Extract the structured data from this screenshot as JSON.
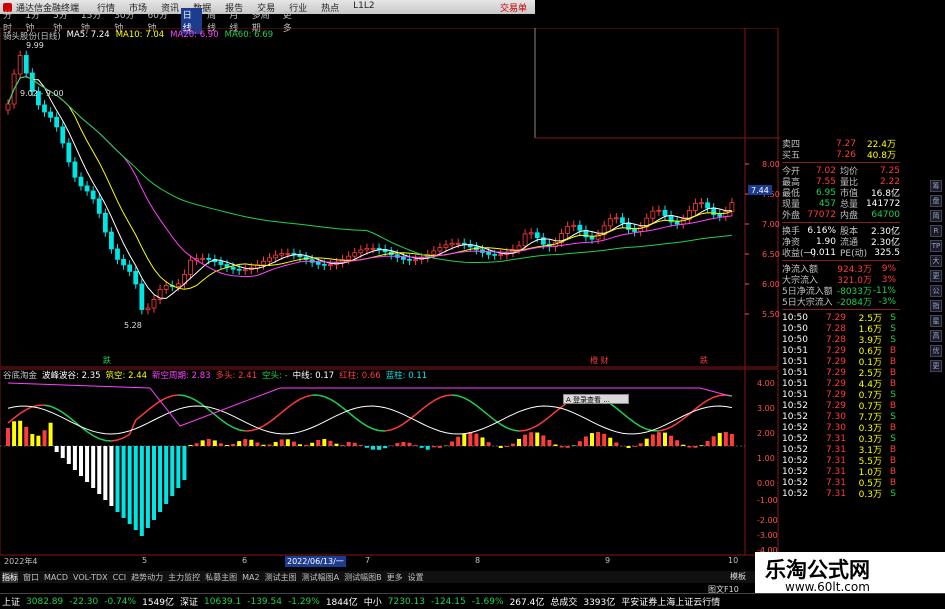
{
  "titlebar": {
    "app": "通达信金融终端",
    "menu": [
      "行情",
      "市场",
      "资讯",
      "数据",
      "报告",
      "交易",
      "行业",
      "热点",
      "L1L2"
    ],
    "badge": "交易单"
  },
  "periods": [
    "分时",
    "1分钟",
    "5分钟",
    "15分钟",
    "30分钟",
    "60分钟",
    "日线",
    "周线",
    "月线",
    "多周期",
    "更多"
  ],
  "selected_period": "日线",
  "ma_legend": {
    "name": "骑头股份(日线)",
    "items": [
      {
        "label": "MA5: 7.24",
        "color": "#ffffff"
      },
      {
        "label": "MA10: 7.04",
        "color": "#ffff00"
      },
      {
        "label": "MA20: 6.90",
        "color": "#ff40ff"
      },
      {
        "label": "MA60: 6.69",
        "color": "#20d050"
      }
    ]
  },
  "annotations": {
    "high": "9.99",
    "mid": "9.02 - 9.00",
    "low": "5.28",
    "tag_left": "跌",
    "tag_mid": "橙 财",
    "tag_right": "跌",
    "tooltip": "A 登录查看 ..."
  },
  "indicator_legend": [
    {
      "label": "谷底淘金",
      "color": "#c0c0c0"
    },
    {
      "label": "波峰波谷: 2.35",
      "color": "#ffffff"
    },
    {
      "label": "筑空: 2.44",
      "color": "#ffff00"
    },
    {
      "label": "新空周期: 2.83",
      "color": "#ff40ff"
    },
    {
      "label": "多头: 2.41",
      "color": "#ff3b3b"
    },
    {
      "label": "空头: -",
      "color": "#20d050"
    },
    {
      "label": "中线: 0.17",
      "color": "#ffffff"
    },
    {
      "label": "红柱: 0.66",
      "color": "#ff3b3b"
    },
    {
      "label": "蓝柱: 0.11",
      "color": "#00e5e5"
    }
  ],
  "price_axis": [
    "8.00",
    "7.50",
    "7.00",
    "6.50",
    "6.00",
    "5.50"
  ],
  "price_tag": "7.44",
  "ind_axis": [
    "4.00",
    "3.00",
    "2.00",
    "1.00",
    "0.00",
    "-1.00",
    "-2.00",
    "-3.00",
    "-4.00"
  ],
  "date_axis": [
    {
      "label": "2022年4",
      "color": "#c0c0c0"
    },
    {
      "label": "5",
      "color": "#c0c0c0"
    },
    {
      "label": "6",
      "color": "#c0c0c0"
    },
    {
      "label": "2022/06/13/一",
      "color": "#ffffff"
    },
    {
      "label": "7",
      "color": "#c0c0c0"
    },
    {
      "label": "8",
      "color": "#c0c0c0"
    },
    {
      "label": "9",
      "color": "#c0c0c0"
    },
    {
      "label": "10",
      "color": "#c0c0c0"
    }
  ],
  "bottom_tabs": [
    "指标",
    "窗口",
    "MACD",
    "VOL-TDX",
    "CCI",
    "趋势动力",
    "主力监控",
    "私募主图",
    "MA2",
    "测试主图",
    "测试幅图A",
    "测试幅图B",
    "更多",
    "设置"
  ],
  "bottom_right": "图文F10",
  "bottom_right2": "模板",
  "quote": {
    "asks_top": [
      {
        "k": "卖四",
        "p": "7.27",
        "v": "22.4万"
      },
      {
        "k": "买五",
        "p": "7.26",
        "v": "40.8万"
      }
    ],
    "stats": [
      {
        "k1": "今开",
        "v1": "7.02",
        "c1": "up",
        "k2": "均价",
        "v2": "7.25",
        "c2": "up"
      },
      {
        "k1": "最高",
        "v1": "7.55",
        "c1": "up",
        "k2": "量比",
        "v2": "2.22",
        "c2": "up"
      },
      {
        "k1": "最低",
        "v1": "6.95",
        "c1": "dn",
        "k2": "市值",
        "v2": "16.8亿",
        "c2": "wh"
      },
      {
        "k1": "现量",
        "v1": "457",
        "c1": "dn",
        "k2": "总量",
        "v2": "141772",
        "c2": "wh"
      },
      {
        "k1": "外盘",
        "v1": "77072",
        "c1": "up",
        "k2": "内盘",
        "v2": "64700",
        "c2": "dn"
      }
    ],
    "stats2": [
      {
        "k1": "换手",
        "v1": "6.16%",
        "k2": "股本",
        "v2": "2.30亿"
      },
      {
        "k1": "净资",
        "v1": "1.90",
        "k2": "流通",
        "v2": "2.30亿"
      },
      {
        "k1": "收益(一)",
        "v1": "0.011",
        "k2": "PE(动)",
        "v2": "325.5"
      }
    ],
    "flows": [
      {
        "k": "净流入额",
        "v": "924.3万",
        "p": "9%",
        "c": "up"
      },
      {
        "k": "大宗流入",
        "v": "321.0万",
        "p": "3%",
        "c": "up"
      },
      {
        "k": "5日净流入额",
        "v": "-8033万",
        "p": "-11%",
        "c": "dn"
      },
      {
        "k": "5日大宗流入",
        "v": "-2084万",
        "p": "-3%",
        "c": "dn"
      }
    ],
    "ticks": [
      {
        "t": "10:50",
        "p": "7.29",
        "v": "2.5万",
        "s": "S"
      },
      {
        "t": "10:50",
        "p": "7.28",
        "v": "1.6万",
        "s": "S"
      },
      {
        "t": "10:50",
        "p": "7.28",
        "v": "3.9万",
        "s": "S"
      },
      {
        "t": "10:51",
        "p": "7.29",
        "v": "0.6万",
        "s": "B"
      },
      {
        "t": "10:51",
        "p": "7.29",
        "v": "0.1万",
        "s": "B"
      },
      {
        "t": "10:51",
        "p": "7.29",
        "v": "2.5万",
        "s": "B"
      },
      {
        "t": "10:51",
        "p": "7.29",
        "v": "4.4万",
        "s": "B"
      },
      {
        "t": "10:51",
        "p": "7.29",
        "v": "0.7万",
        "s": "S"
      },
      {
        "t": "10:52",
        "p": "7.29",
        "v": "0.7万",
        "s": "B"
      },
      {
        "t": "10:52",
        "p": "7.30",
        "v": "7.7万",
        "s": "S"
      },
      {
        "t": "10:52",
        "p": "7.30",
        "v": "0.3万",
        "s": "B"
      },
      {
        "t": "10:52",
        "p": "7.31",
        "v": "0.3万",
        "s": "S"
      },
      {
        "t": "10:52",
        "p": "7.31",
        "v": "3.1万",
        "s": "B"
      },
      {
        "t": "10:52",
        "p": "7.31",
        "v": "5.5万",
        "s": "B"
      },
      {
        "t": "10:52",
        "p": "7.31",
        "v": "1.0万",
        "s": "B"
      },
      {
        "t": "10:52",
        "p": "7.31",
        "v": "0.5万",
        "s": "B"
      },
      {
        "t": "10:52",
        "p": "7.31",
        "v": "0.3万",
        "s": "S"
      }
    ]
  },
  "right_toolbar": [
    "筹",
    "盘",
    "简",
    "R",
    "TP",
    "大",
    "更",
    "公",
    "指",
    "星",
    "高",
    "优",
    "更"
  ],
  "status": [
    {
      "label": "上证",
      "c": "wh"
    },
    {
      "label": "3082.89",
      "c": "dn"
    },
    {
      "label": "-22.30",
      "c": "dn"
    },
    {
      "label": "-0.74%",
      "c": "dn"
    },
    {
      "label": "1549亿",
      "c": "wh"
    },
    {
      "label": "深证",
      "c": "wh"
    },
    {
      "label": "10639.1",
      "c": "dn"
    },
    {
      "label": "-139.54",
      "c": "dn"
    },
    {
      "label": "-1.29%",
      "c": "dn"
    },
    {
      "label": "1844亿",
      "c": "wh"
    },
    {
      "label": "中小",
      "c": "wh"
    },
    {
      "label": "7230.13",
      "c": "dn"
    },
    {
      "label": "-124.15",
      "c": "dn"
    },
    {
      "label": "-1.69%",
      "c": "dn"
    },
    {
      "label": "267.4亿",
      "c": "wh"
    },
    {
      "label": "总成交",
      "c": "wh"
    },
    {
      "label": "3393亿",
      "c": "wh"
    },
    {
      "label": "平安证券上海上证云行情",
      "c": "wh"
    }
  ],
  "watermark": {
    "title": "乐淘公式网",
    "url": "www.60lt.com"
  },
  "colors": {
    "up": "#ff3b3b",
    "down": "#20d050",
    "ma5": "#ffffff",
    "ma10": "#ffff00",
    "ma20": "#ff40ff",
    "ma60": "#20d050",
    "grid": "#801818"
  }
}
